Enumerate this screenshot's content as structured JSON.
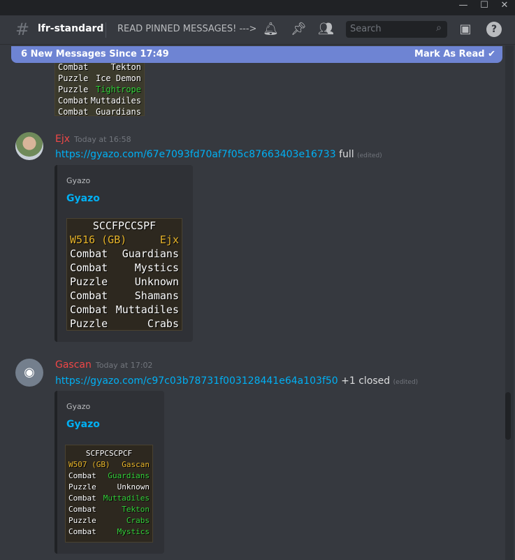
{
  "window": {
    "minimize": "—",
    "maximize": "☐",
    "close": "✕"
  },
  "header": {
    "channel": "lfr-standard",
    "topic": "READ PINNED MESSAGES! --->",
    "search_placeholder": "Search",
    "icons": [
      "hash-lock-icon",
      "bell-icon",
      "pin-icon",
      "members-icon",
      "search-icon",
      "inbox-icon",
      "help-icon"
    ]
  },
  "banner": {
    "text": "6 New Messages Since 17:49",
    "action": "Mark As Read"
  },
  "colors": {
    "accent": "#6e84d3",
    "link": "#00b0f4",
    "username": "#f04747",
    "rs_yellow": "#e8b52a",
    "rs_green": "#33d33a"
  },
  "prev_image": {
    "rows": [
      [
        "Combat",
        "Tekton",
        ""
      ],
      [
        "Puzzle",
        "Ice Demon",
        ""
      ],
      [
        "Puzzle",
        "Tightrope",
        "g"
      ],
      [
        "Combat",
        "Muttadiles",
        ""
      ],
      [
        "Combat",
        "Guardians",
        ""
      ]
    ]
  },
  "messages": [
    {
      "author": "Ejx",
      "time": "Today at 16:58",
      "link": "https://gyazo.com/67e7093fd70af7f05c87663403e16733",
      "text": "full",
      "edited": "(edited)",
      "embed": {
        "provider": "Gyazo",
        "title": "Gyazo",
        "image": {
          "title": "SCCFPCCSPF",
          "world": "W516 (GB)",
          "player": "Ejx",
          "rows": [
            [
              "Combat",
              "Guardians",
              ""
            ],
            [
              "Combat",
              "Mystics",
              ""
            ],
            [
              "Puzzle",
              "Unknown",
              ""
            ],
            [
              "Combat",
              "Shamans",
              ""
            ],
            [
              "Combat",
              "Muttadiles",
              ""
            ],
            [
              "Puzzle",
              "Crabs",
              ""
            ]
          ]
        }
      }
    },
    {
      "author": "Gascan",
      "time": "Today at 17:02",
      "link": "https://gyazo.com/c97c03b78731f003128441e64a103f50",
      "text": "+1 closed",
      "edited": "(edited)",
      "embed": {
        "provider": "Gyazo",
        "title": "Gyazo",
        "image": {
          "title": "SCFPCSCPCF",
          "world": "W507 (GB)",
          "player": "Gascan",
          "rows": [
            [
              "Combat",
              "Guardians",
              "g"
            ],
            [
              "Puzzle",
              "Unknown",
              ""
            ],
            [
              "Combat",
              "Muttadiles",
              "g"
            ],
            [
              "Combat",
              "Tekton",
              "g"
            ],
            [
              "Puzzle",
              "Crabs",
              "g"
            ],
            [
              "Combat",
              "Mystics",
              "g"
            ]
          ]
        }
      }
    }
  ]
}
